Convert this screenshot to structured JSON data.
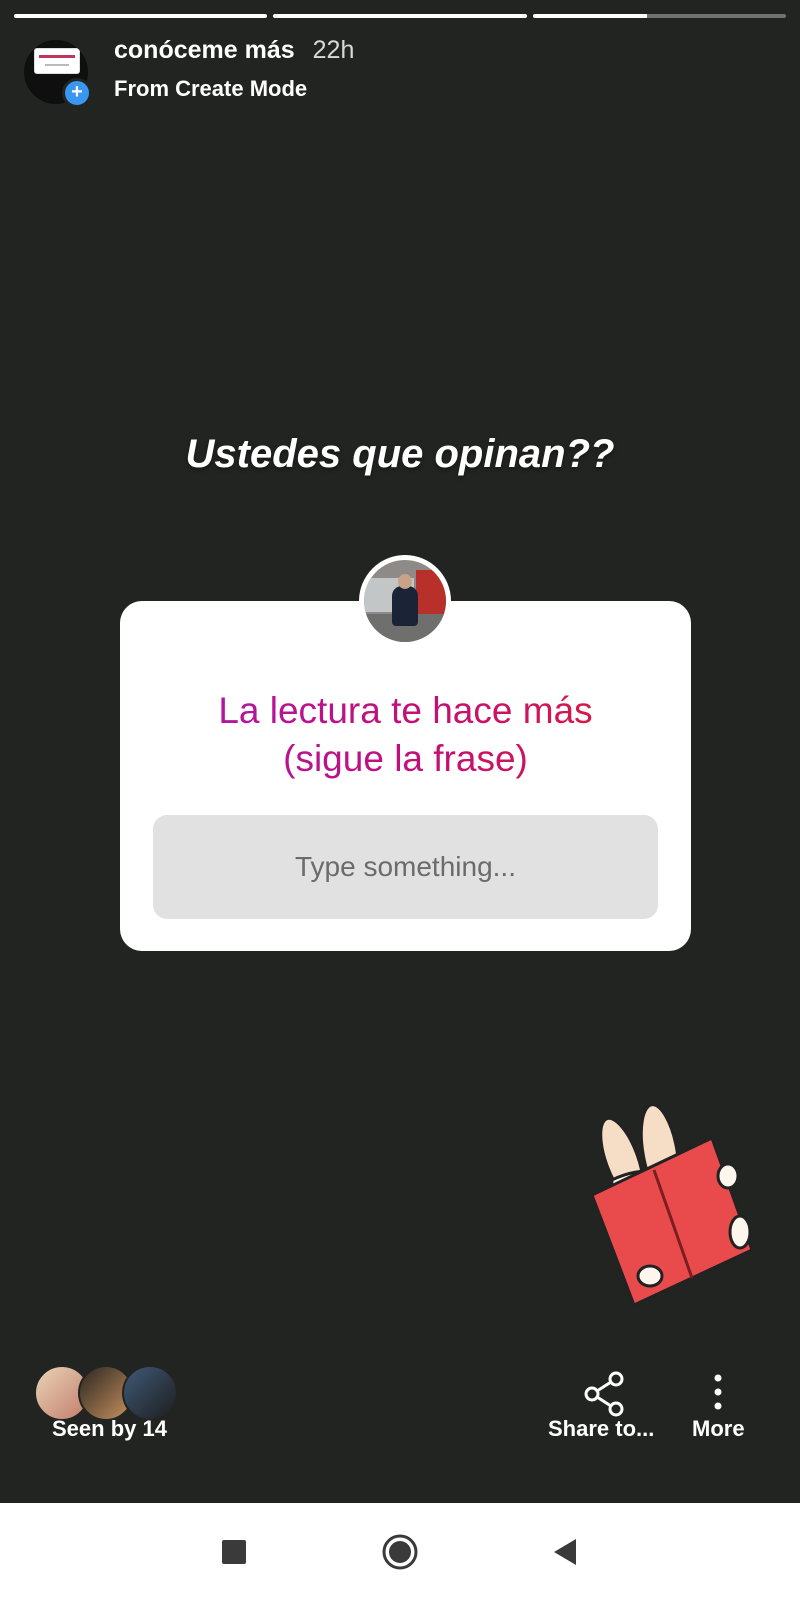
{
  "progress": [
    1.0,
    1.0,
    0.45
  ],
  "story": {
    "username": "conóceme más",
    "time_ago": "22h",
    "subtitle": "From Create Mode"
  },
  "caption": "Ustedes que opinan??",
  "question_sticker": {
    "question_line1": "La lectura te hace más",
    "question_line2": "(sigue la frase)",
    "placeholder": "Type something..."
  },
  "footer": {
    "seen_label": "Seen by 14",
    "share_label": "Share to...",
    "more_label": "More"
  },
  "colors": {
    "background": "#222422",
    "question_gradient_start": "#a919b4",
    "question_gradient_end": "#e01e2e",
    "add_badge": "#3897f0"
  },
  "icons": {
    "add": "plus-circle-icon",
    "share": "share-icon",
    "more": "vertical-dots-icon",
    "nav_recent": "square-icon",
    "nav_home": "circle-icon",
    "nav_back": "triangle-back-icon"
  }
}
